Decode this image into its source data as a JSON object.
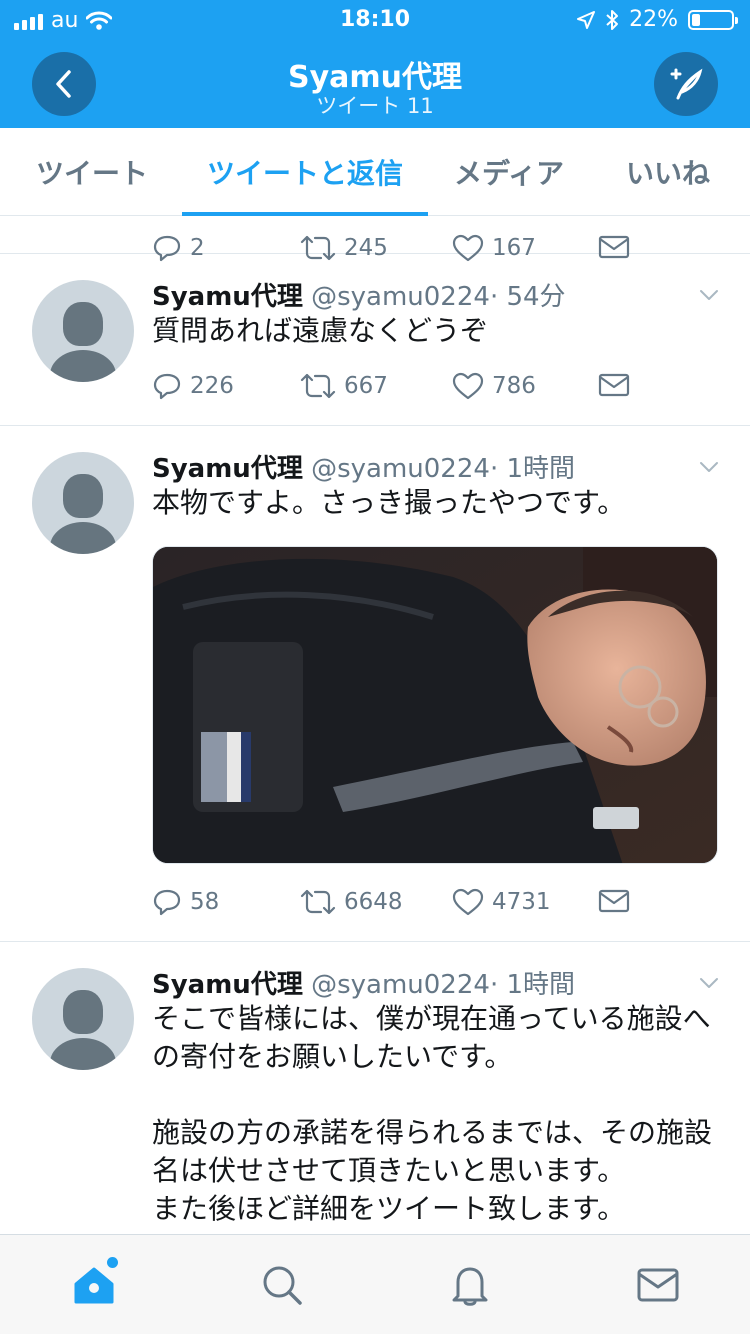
{
  "status_bar": {
    "carrier": "au",
    "time": "18:10",
    "battery_percent": "22%",
    "battery_level": 0.22
  },
  "header": {
    "title": "Syamu代理",
    "subtitle": "ツイート 11"
  },
  "tabs": [
    {
      "label": "ツイート",
      "active": false
    },
    {
      "label": "ツイートと返信",
      "active": true
    },
    {
      "label": "メディア",
      "active": false
    },
    {
      "label": "いいね",
      "active": false
    }
  ],
  "partial_tweet": {
    "replies": "2",
    "retweets": "245",
    "likes": "167"
  },
  "tweets": [
    {
      "name": "Syamu代理",
      "handle": "@syamu0224",
      "time": "· 54分",
      "text": "質問あれば遠慮なくどうぞ",
      "replies": "226",
      "retweets": "667",
      "likes": "786"
    },
    {
      "name": "Syamu代理",
      "handle": "@syamu0224",
      "time": "· 1時間",
      "text": "本物ですよ。さっき撮ったやつです。",
      "replies": "58",
      "retweets": "6648",
      "likes": "4731"
    },
    {
      "name": "Syamu代理",
      "handle": "@syamu0224",
      "time": "· 1時間",
      "text": "そこで皆様には、僕が現在通っている施設への寄付をお願いしたいです。\n\n施設の方の承諾を得られるまでは、その施設名は伏せさせて頂きたいと思います。\nまた後ほど詳細をツイート致します。"
    }
  ],
  "colors": {
    "brand": "#1da1f2",
    "secondary_text": "#657786"
  }
}
